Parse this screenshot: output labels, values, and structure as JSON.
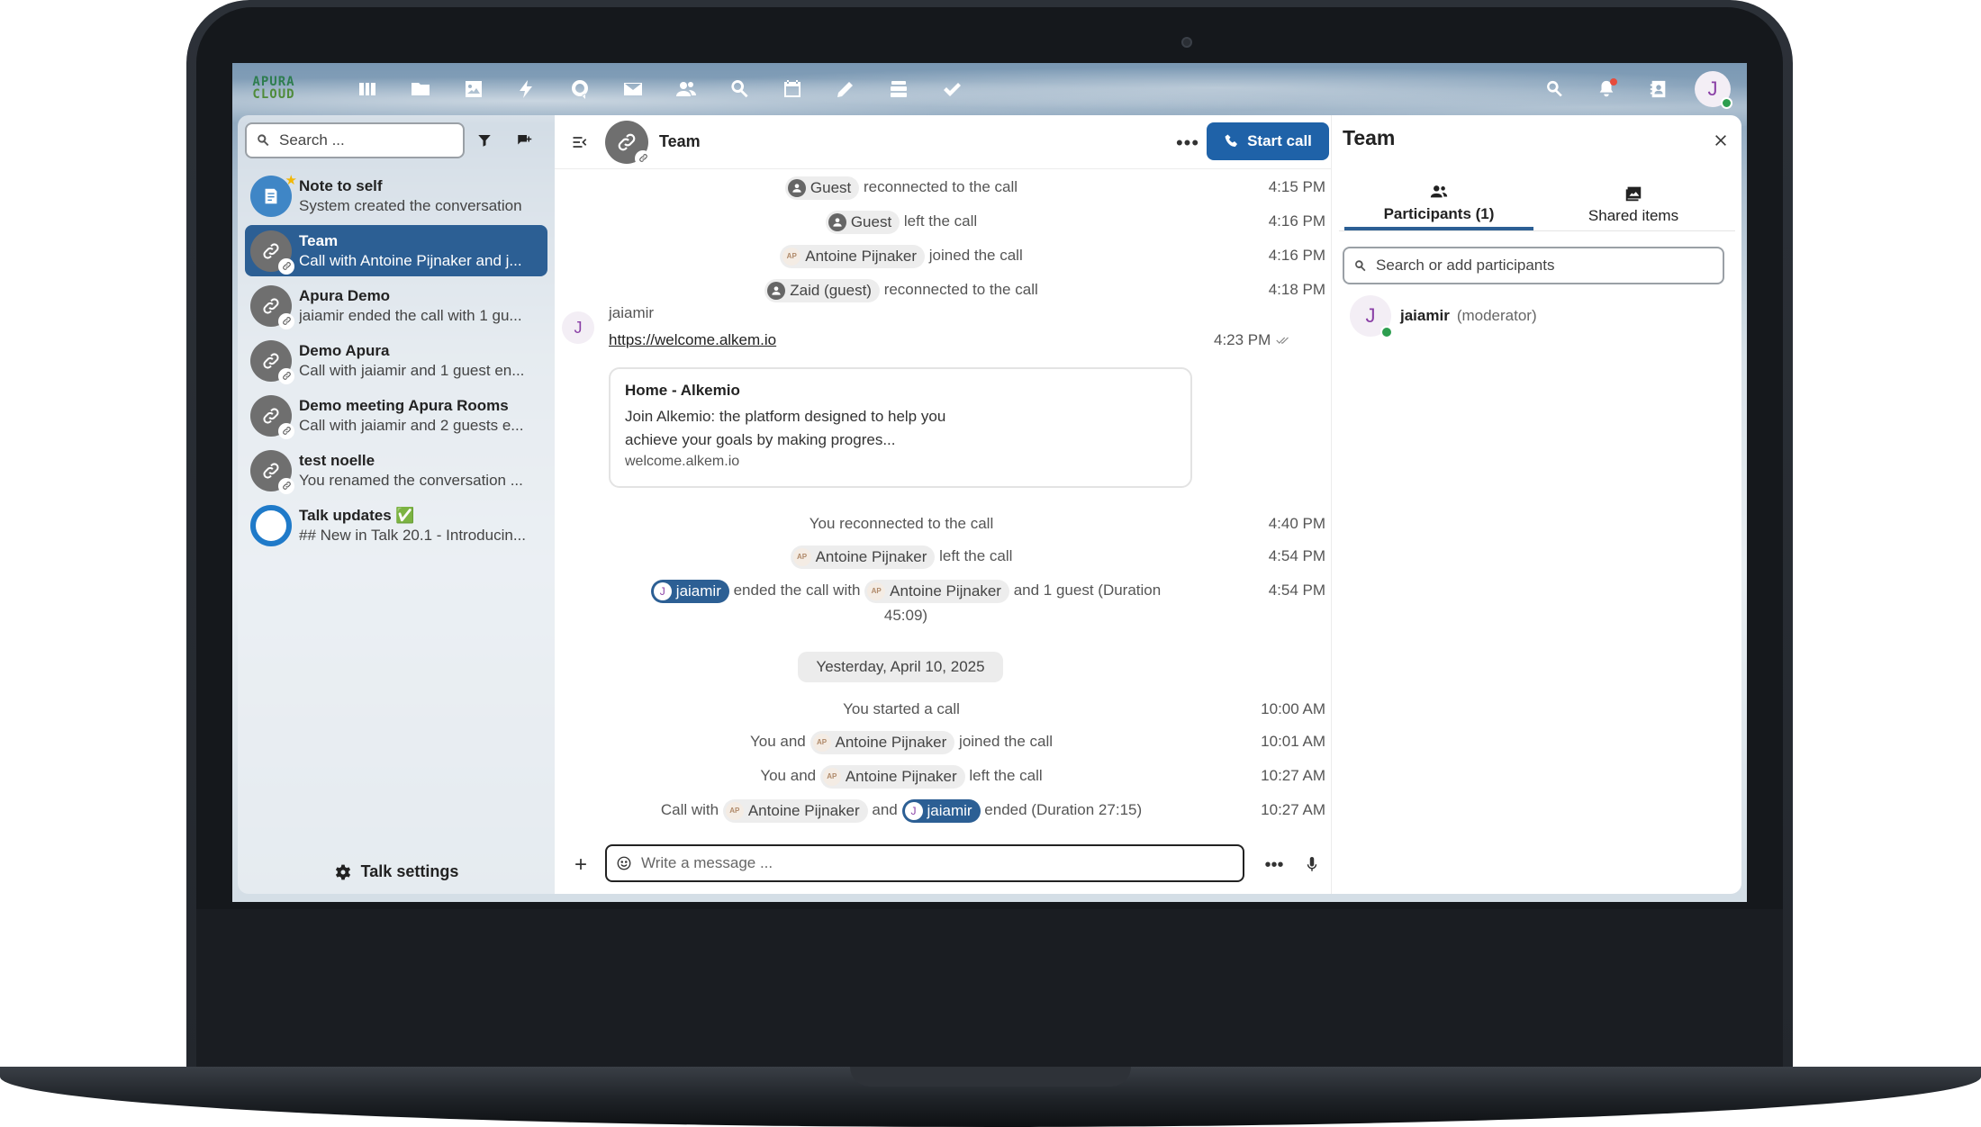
{
  "topbar": {
    "brand_line1": "APURA",
    "brand_line2": "CLOUD",
    "apps": [
      "dashboard-icon",
      "files-icon",
      "photos-icon",
      "activity-icon",
      "talk-icon",
      "mail-icon",
      "contacts-icon",
      "search-app-icon",
      "calendar-icon",
      "notes-icon",
      "deck-icon",
      "tasks-icon"
    ],
    "avatar_initial": "J"
  },
  "sidebar": {
    "search_placeholder": "Search ...",
    "conversations": [
      {
        "name": "Note to self",
        "preview": "System created the conversation",
        "icon": "note-icon"
      },
      {
        "name": "Team",
        "preview": "Call with Antoine Pijnaker and j...",
        "icon": "link-icon",
        "active": true
      },
      {
        "name": "Apura Demo",
        "preview": "jaiamir ended the call with 1 gu...",
        "icon": "link-icon"
      },
      {
        "name": "Demo Apura",
        "preview": "Call with jaiamir and 1 guest en...",
        "icon": "link-icon"
      },
      {
        "name": "Demo meeting Apura Rooms",
        "preview": "Call with jaiamir and 2 guests e...",
        "icon": "link-icon"
      },
      {
        "name": "test noelle",
        "preview": "You renamed the conversation ...",
        "icon": "link-icon"
      },
      {
        "name": "Talk updates ✅",
        "preview": "## New in Talk 20.1 - Introducin...",
        "icon": "talk-icon"
      }
    ],
    "settings_label": "Talk settings"
  },
  "chat": {
    "title": "Team",
    "start_call_label": "Start call",
    "system_messages_top": [
      {
        "actor": "Guest",
        "text": "reconnected to the call",
        "time": "4:15 PM"
      },
      {
        "actor": "Guest",
        "text": "left the call",
        "time": "4:16 PM"
      },
      {
        "actor": "Antoine Pijnaker",
        "text": "joined the call",
        "time": "4:16 PM"
      },
      {
        "actor": "Zaid (guest)",
        "text": "reconnected to the call",
        "time": "4:18 PM"
      }
    ],
    "message": {
      "author": "jaiamir",
      "avatar_initial": "J",
      "link": "https://welcome.alkem.io",
      "time": "4:23 PM",
      "preview_title": "Home - Alkemio",
      "preview_desc": "Join Alkemio: the platform designed to help you achieve your goals by making progres...",
      "preview_url": "welcome.alkem.io"
    },
    "system_messages_mid": [
      {
        "text": "You reconnected to the call",
        "time": "4:40 PM"
      },
      {
        "actor": "Antoine Pijnaker",
        "text": "left the call",
        "time": "4:54 PM"
      },
      {
        "actor": "jaiamir",
        "text": "ended the call with",
        "actor2": "Antoine Pijnaker",
        "text2": "and 1 guest (Duration 45:09)",
        "time": "4:54 PM"
      }
    ],
    "day_separator": "Yesterday, April 10, 2025",
    "system_messages_bottom": [
      {
        "text": "You started a call",
        "time": "10:00 AM"
      },
      {
        "prefix": "You and",
        "actor": "Antoine Pijnaker",
        "text": "joined the call",
        "time": "10:01 AM"
      },
      {
        "prefix": "You and",
        "actor": "Antoine Pijnaker",
        "text": "left the call",
        "time": "10:27 AM"
      },
      {
        "prefix": "Call with",
        "actor": "Antoine Pijnaker",
        "mid": "and",
        "actor2": "jaiamir",
        "text": "ended (Duration 27:15)",
        "time": "10:27 AM"
      }
    ],
    "composer_placeholder": "Write a message ..."
  },
  "right_panel": {
    "title": "Team",
    "tabs": [
      {
        "label": "Participants (1)",
        "icon": "participants-icon",
        "active": true
      },
      {
        "label": "Shared items",
        "icon": "shared-items-icon"
      }
    ],
    "search_placeholder": "Search or add participants",
    "participants": [
      {
        "name": "jaiamir",
        "role": "(moderator)",
        "initial": "J"
      }
    ]
  }
}
